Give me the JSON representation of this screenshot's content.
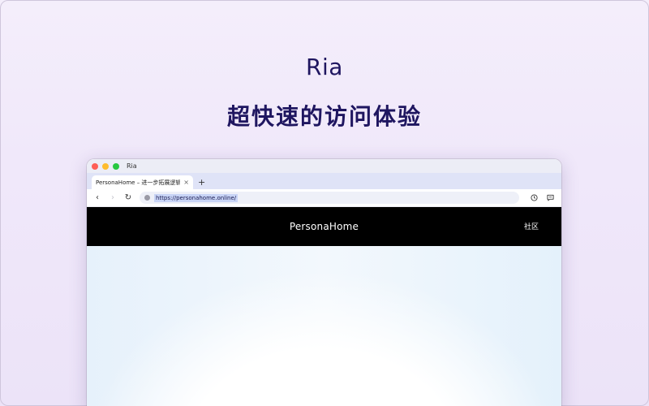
{
  "hero": {
    "title": "Ria",
    "subtitle": "超快速的访问体验"
  },
  "window": {
    "title": "Ria"
  },
  "tabs": [
    {
      "title": "PersonaHome – 进一步拓展逻辑边界",
      "close": "×"
    }
  ],
  "new_tab_label": "+",
  "toolbar": {
    "back": "‹",
    "forward": "›",
    "reload": "↻",
    "url": "https://personahome.online/"
  },
  "site": {
    "brand": "PersonaHome",
    "nav": [
      "社区"
    ]
  },
  "colors": {
    "hero_text": "#1f1660",
    "site_header": "#000000",
    "tabbar": "#dfe3f7",
    "url_highlight": "#c8d4f6"
  },
  "icons": {
    "history": "clock-icon",
    "chat": "chat-bubble-icon",
    "site": "globe-icon"
  }
}
